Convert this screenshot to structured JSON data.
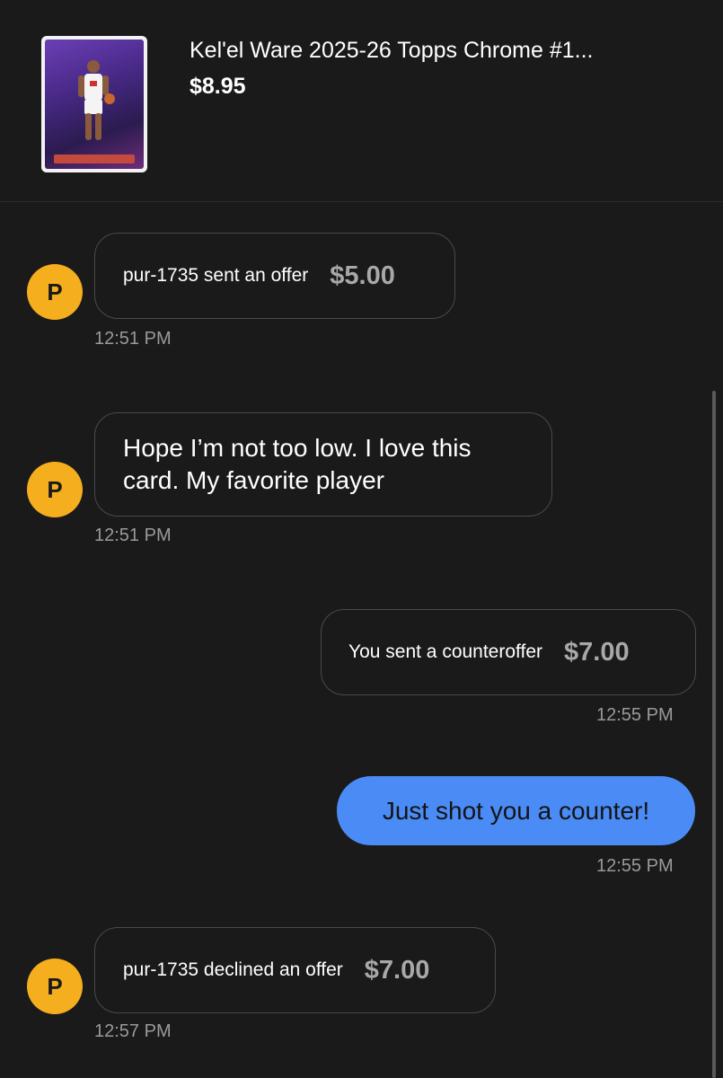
{
  "listing": {
    "title": "Kel'el Ware 2025-26 Topps Chrome #1...",
    "price": "$8.95",
    "thumbnail_icon": "trading-card-thumbnail"
  },
  "messages": [
    {
      "type": "offer",
      "sender": "other",
      "avatar": "P",
      "text": "pur-1735 sent an offer",
      "amount": "$5.00",
      "time": "12:51 PM"
    },
    {
      "type": "text",
      "sender": "other",
      "avatar": "P",
      "text": "Hope I’m not too low. I love this card. My favorite player",
      "time": "12:51 PM"
    },
    {
      "type": "offer",
      "sender": "self",
      "text": "You sent a counteroffer",
      "amount": "$7.00",
      "time": "12:55 PM"
    },
    {
      "type": "text",
      "sender": "self",
      "text": "Just shot you a counter!",
      "time": "12:55 PM"
    },
    {
      "type": "offer",
      "sender": "other",
      "avatar": "P",
      "text": "pur-1735 declined an offer",
      "amount": "$7.00",
      "time": "12:57 PM"
    }
  ],
  "colors": {
    "background": "#1a1a1a",
    "avatar": "#f5ae1d",
    "self_bubble": "#4b8bf5",
    "bubble_border": "#4a4a4a",
    "muted_text": "#9a9a9a",
    "amount_text": "#a8a8a8"
  }
}
